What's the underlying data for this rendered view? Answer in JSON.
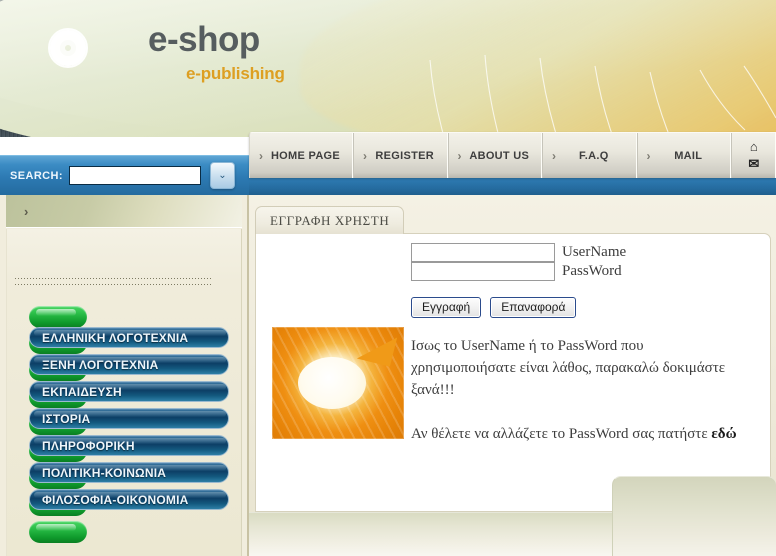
{
  "brand": {
    "title": "e-shop",
    "subtitle": "e-publishing",
    "ring_icon": "concentric-rings-logo"
  },
  "nav": {
    "items": [
      {
        "label": "HOME PAGE",
        "arrow": "›"
      },
      {
        "label": "REGISTER",
        "arrow": "›"
      },
      {
        "label": "ABOUT US",
        "arrow": "›"
      },
      {
        "label": "F.A.Q",
        "arrow": "›"
      },
      {
        "label": "MAIL",
        "arrow": "›"
      }
    ],
    "home_icon": "⌂",
    "mail_icon": "✉"
  },
  "search": {
    "label": "SEARCH:",
    "value": "",
    "placeholder": "",
    "dropdown_icon": "⌄"
  },
  "sidebar": {
    "collapse_arrow": "›",
    "menu": [
      {
        "label": "ΕΛΛΗΝΙΚΗ ΛΟΓΟΤΕΧΝΙΑ"
      },
      {
        "label": "ΞΕΝΗ ΛΟΓΟΤΕΧΝΙΑ"
      },
      {
        "label": "ΕΚΠΑΙΔΕΥΣΗ"
      },
      {
        "label": "ΙΣΤΟΡΙΑ"
      },
      {
        "label": "ΠΛΗΡΟΦΟΡΙΚΗ"
      },
      {
        "label": "ΠΟΛΙΤΙΚΗ-ΚΟΙΝΩΝΙΑ"
      },
      {
        "label": "ΦΙΛΟΣΟΦΙΑ-ΟΙΚΟΝΟΜΙΑ"
      }
    ]
  },
  "main": {
    "tab_label": "ΕΓΓΡΑΦΗ ΧΡΗΣΤΗ",
    "thumbnail_icon": "orange-circular-arrow-logo",
    "fields": [
      {
        "label": "UserName",
        "value": "",
        "placeholder": ""
      },
      {
        "label": "PassWord",
        "value": "",
        "placeholder": ""
      }
    ],
    "buttons": [
      {
        "label": "Εγγραφή"
      },
      {
        "label": "Επαναφορά"
      }
    ],
    "error_message": "Ισως το UserName ή το PassWord που χρησιμοποιήσατε είναι λάθος, παρακαλώ δοκιμάστε ξανά!!!",
    "help_text": "Αν θέλετε να αλλάζετε το PassWord σας πατήστε ",
    "help_link": "εδώ"
  },
  "colors": {
    "search_bar_blue": "#2d7ab3",
    "brand_gold": "#dd9f22",
    "brand_gray": "#565d5f",
    "menu_pill_blue": "#0d3f66",
    "menu_pill_green": "#27bb45",
    "thumb_orange": "#ef8f12"
  }
}
